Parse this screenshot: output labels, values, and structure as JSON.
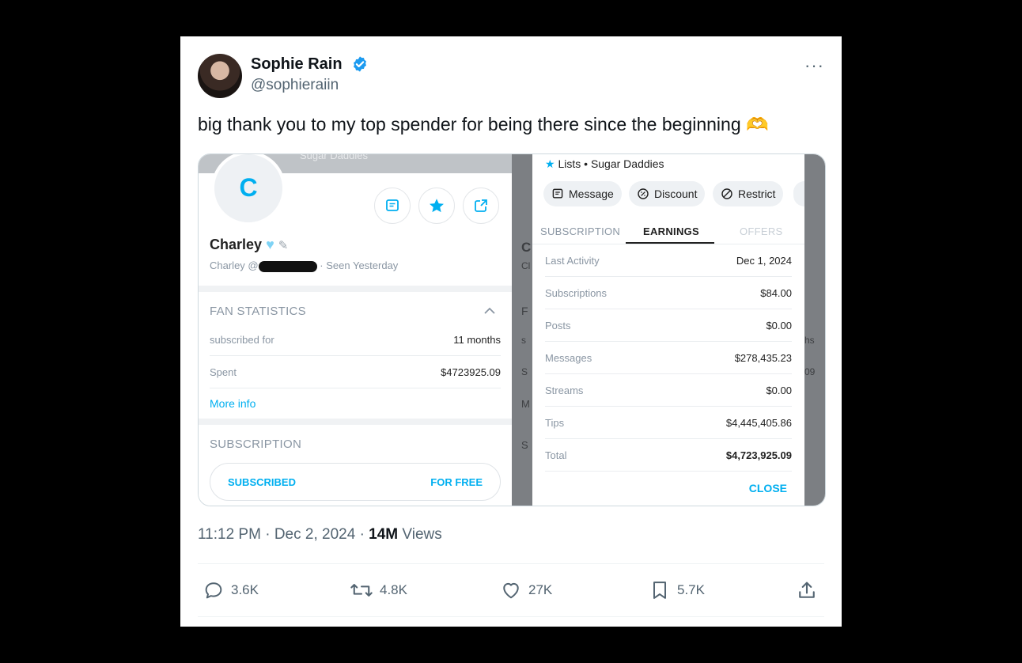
{
  "tweet": {
    "author_name": "Sophie Rain",
    "handle": "@sophieraiin",
    "more_label": "···",
    "text": "big thank you to my top spender for being there since the beginning",
    "emoji": "🫶",
    "time": "11:12 PM",
    "sep1": "·",
    "date": "Dec 2, 2024",
    "sep2": "·",
    "views_count": "14M",
    "views_label": "Views"
  },
  "actions": {
    "replies": "3.6K",
    "reposts": "4.8K",
    "likes": "27K",
    "bookmarks": "5.7K"
  },
  "screenshot_left": {
    "banner_text": "Sugar Daddies",
    "avatar_letter": "C",
    "fan_name": "Charley",
    "fan_handle_prefix": "Charley @",
    "dot": "·",
    "seen": "Seen",
    "seen_when": "Yesterday",
    "fan_stats_title": "FAN STATISTICS",
    "stats": [
      {
        "label": "subscribed for",
        "value": "11 months"
      },
      {
        "label": "Spent",
        "value": "$4723925.09"
      }
    ],
    "more_info": "More info",
    "subscription_title": "SUBSCRIPTION",
    "subscribed_label": "SUBSCRIBED",
    "for_free_label": "FOR FREE"
  },
  "screenshot_right": {
    "lists_label": "Lists",
    "lists_dot": "•",
    "lists_value": "Sugar Daddies",
    "chips": [
      "Message",
      "Discount",
      "Restrict"
    ],
    "tabs": [
      "SUBSCRIPTION",
      "EARNINGS",
      "OFFERS"
    ],
    "earnings": [
      {
        "label": "Last Activity",
        "value": "Dec 1, 2024"
      },
      {
        "label": "Subscriptions",
        "value": "$84.00"
      },
      {
        "label": "Posts",
        "value": "$0.00"
      },
      {
        "label": "Messages",
        "value": "$278,435.23"
      },
      {
        "label": "Streams",
        "value": "$0.00"
      },
      {
        "label": "Tips",
        "value": "$4,445,405.86"
      },
      {
        "label": "Total",
        "value": "$4,723,925.09"
      }
    ],
    "close_label": "CLOSE",
    "ghost_glyphs": [
      "C",
      "Cl",
      "F",
      "s",
      "S",
      "M",
      "S",
      "hs",
      "09"
    ]
  },
  "colors": {
    "accent": "#00aff0",
    "verified": "#1d9bf0",
    "text_primary": "#0f1419",
    "text_secondary": "#536471"
  }
}
